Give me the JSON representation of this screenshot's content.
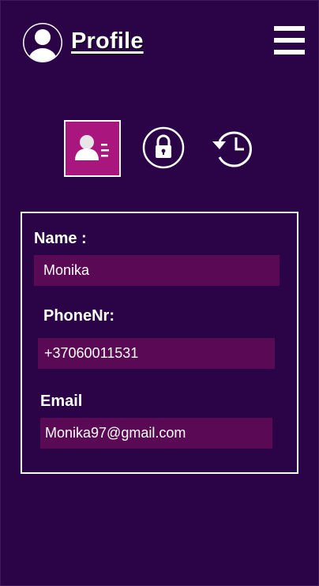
{
  "header": {
    "avatar_icon": "user-avatar-icon",
    "title": "Profile",
    "menu_icon": "hamburger-menu-icon"
  },
  "tabs": [
    {
      "icon": "contact-card-icon",
      "active": true
    },
    {
      "icon": "lock-icon",
      "active": false
    },
    {
      "icon": "history-clock-icon",
      "active": false
    }
  ],
  "form": {
    "name": {
      "label": "Name :",
      "value": "Monika"
    },
    "phone": {
      "label": "PhoneNr:",
      "value": "+37060011531"
    },
    "email": {
      "label": "Email",
      "value": "Monika97@gmail.com"
    }
  },
  "colors": {
    "background": "#2a0446",
    "active_tab": "#a8167e",
    "input_background": "#5a0a54",
    "text": "#ffffff"
  }
}
